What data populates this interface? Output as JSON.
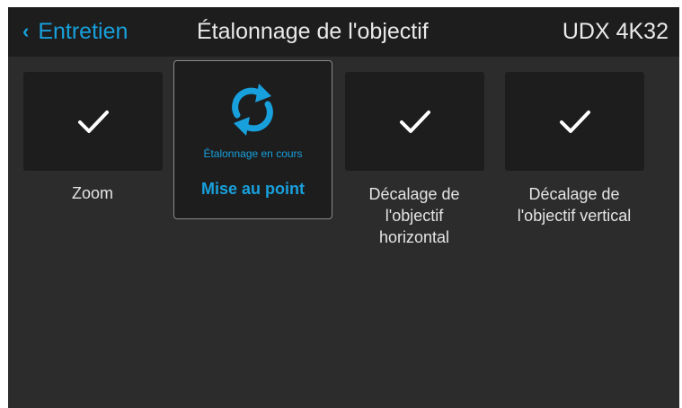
{
  "header": {
    "back_label": "Entretien",
    "title": "Étalonnage de l'objectif",
    "model": "UDX 4K32"
  },
  "tiles": [
    {
      "label": "Zoom",
      "icon": "check-icon",
      "state": "done"
    },
    {
      "label": "Mise au point",
      "status": "Étalonnage en cours",
      "icon": "sync-icon",
      "state": "in-progress"
    },
    {
      "label_lines": [
        "Décalage de",
        "l'objectif",
        "horizontal"
      ],
      "icon": "check-icon",
      "state": "done"
    },
    {
      "label_lines": [
        "Décalage de",
        "l'objectif vertical"
      ],
      "icon": "check-icon",
      "state": "done"
    }
  ],
  "colors": {
    "accent": "#18a0dc",
    "background": "#2d2c2c",
    "panel": "#1d1d1d",
    "text": "#e9e9e9"
  }
}
